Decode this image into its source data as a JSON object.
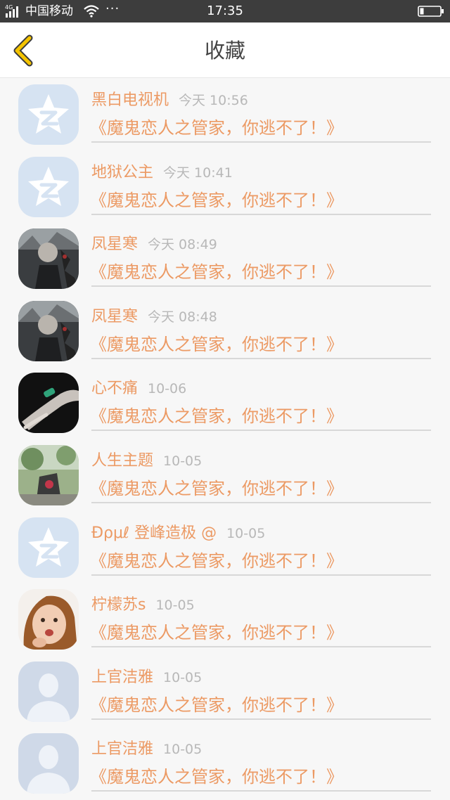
{
  "status_bar": {
    "network": "4G",
    "carrier": "中国移动",
    "more": "···",
    "time": "17:35"
  },
  "header": {
    "title": "收藏",
    "accent_color": "#f5c400"
  },
  "colors": {
    "accent": "#ec9a64",
    "timestamp": "#b8b8b8"
  },
  "items": [
    {
      "name": "黑白电视机",
      "time": "今天 10:56",
      "book": "《魔鬼恋人之管家，你逃不了！》",
      "avatar": "default-star-avatar"
    },
    {
      "name": "地狱公主",
      "time": "今天 10:41",
      "book": "《魔鬼恋人之管家，你逃不了！》",
      "avatar": "default-star-avatar"
    },
    {
      "name": "凤星寒",
      "time": "今天 08:49",
      "book": "《魔鬼恋人之管家，你逃不了！》",
      "avatar": "dark-anime-avatar"
    },
    {
      "name": "凤星寒",
      "time": "今天 08:48",
      "book": "《魔鬼恋人之管家，你逃不了！》",
      "avatar": "dark-anime-avatar"
    },
    {
      "name": "心不痛",
      "time": "10-06",
      "book": "《魔鬼恋人之管家，你逃不了！》",
      "avatar": "hand-photo-avatar"
    },
    {
      "name": "人生主题",
      "time": "10-05",
      "book": "《魔鬼恋人之管家，你逃不了！》",
      "avatar": "outdoor-photo-avatar"
    },
    {
      "name": "Ðρμℓ 登峰造极 @",
      "time": "10-05",
      "book": "《魔鬼恋人之管家，你逃不了！》",
      "avatar": "default-star-avatar"
    },
    {
      "name": "柠檬苏s",
      "time": "10-05",
      "book": "《魔鬼恋人之管家，你逃不了！》",
      "avatar": "girl-photo-avatar"
    },
    {
      "name": "上官洁雅",
      "time": "10-05",
      "book": "《魔鬼恋人之管家，你逃不了！》",
      "avatar": "default-person-avatar"
    },
    {
      "name": "上官洁雅",
      "time": "10-05",
      "book": "《魔鬼恋人之管家，你逃不了！》",
      "avatar": "default-person-avatar"
    }
  ]
}
